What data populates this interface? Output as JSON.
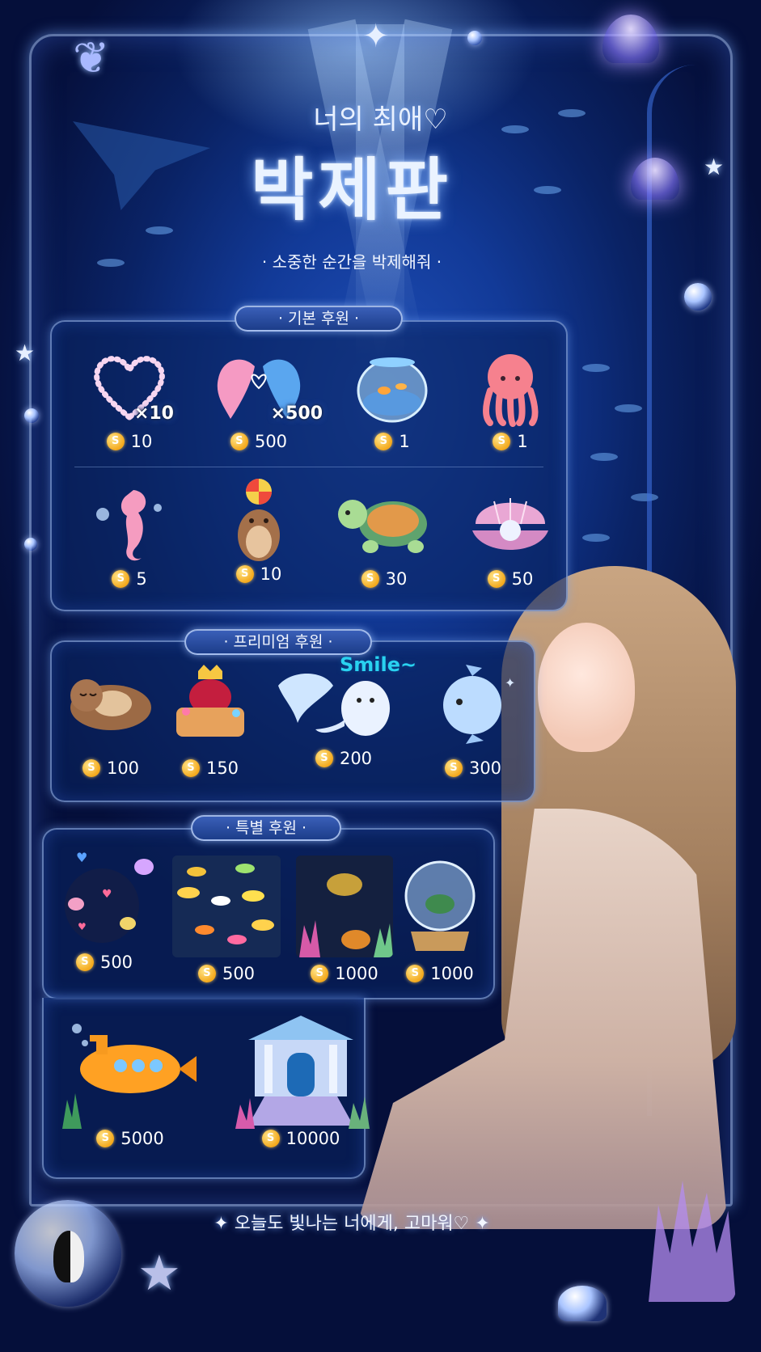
{
  "header": {
    "subtitle": "너의 최애♡",
    "title": "박제판",
    "tagline": "· 소중한 순간을 박제해줘 ·"
  },
  "sections": {
    "basic": {
      "label": "· 기본 후원 ·",
      "items": [
        {
          "icon": "heart-wreath-icon",
          "badge": "×10",
          "price": "10"
        },
        {
          "icon": "dolphins-icon",
          "badge": "×500",
          "price": "500"
        },
        {
          "icon": "fishbowl-icon",
          "price": "1"
        },
        {
          "icon": "octopus-icon",
          "price": "1"
        },
        {
          "icon": "seahorse-icon",
          "price": "5"
        },
        {
          "icon": "otter-ball-icon",
          "price": "10"
        },
        {
          "icon": "turtle-icon",
          "price": "30"
        },
        {
          "icon": "pearl-shell-icon",
          "price": "50"
        }
      ]
    },
    "premium": {
      "label": "· 프리미엄 후원 ·",
      "smile_text": "Smile~",
      "items": [
        {
          "icon": "sleeping-otter-icon",
          "price": "100"
        },
        {
          "icon": "treasure-cake-icon",
          "price": "150"
        },
        {
          "icon": "stingray-seal-icon",
          "price": "200"
        },
        {
          "icon": "sunfish-icon",
          "price": "300"
        }
      ]
    },
    "special": {
      "label": "· 특별 후원 ·",
      "items": [
        {
          "icon": "jellyfish-scene-icon",
          "price": "500"
        },
        {
          "icon": "tropical-fish-scene-icon",
          "price": "500"
        },
        {
          "icon": "turtle-reef-scene-icon",
          "price": "1000"
        },
        {
          "icon": "snow-globe-icon",
          "price": "1000"
        },
        {
          "icon": "submarine-icon",
          "price": "5000"
        },
        {
          "icon": "palace-icon",
          "price": "10000"
        }
      ]
    }
  },
  "coin_symbol": "S",
  "footer": "✦  오늘도 빛나는 너에게, 고마워♡  ✦",
  "colors": {
    "background": "#0a2366",
    "panel": "#0a235f",
    "coin": "#f4a91c",
    "accent": "#7fb2ff",
    "smile": "#29d2f0"
  }
}
